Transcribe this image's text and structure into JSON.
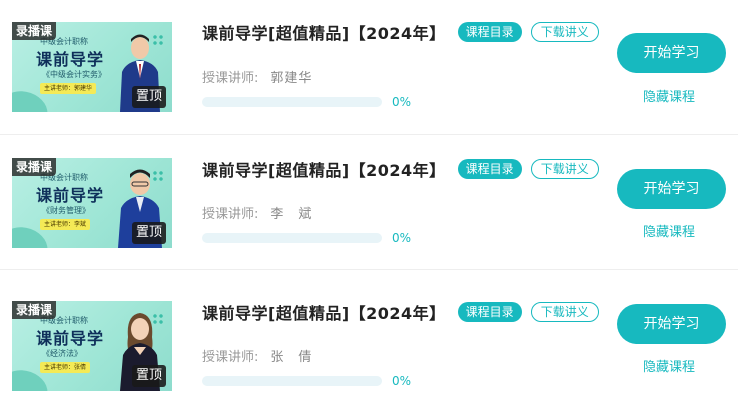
{
  "courses": [
    {
      "thumb": {
        "badge": "录播课",
        "subtitle": "中级会计职称",
        "big_title": "课前导学",
        "tagline": "《中级会计实务》",
        "teacher_pill": "主讲老师：郭建华",
        "pin_tag": "置顶",
        "suit_color": "#1f3a8a"
      },
      "title": "课前导学[超值精品]【2024年】",
      "catalog_label": "课程目录",
      "download_label": "下载讲义",
      "teacher_label": "授课讲师:",
      "teacher_name": "郭建华",
      "progress": 0,
      "progress_text": "0%",
      "start_label": "开始学习",
      "hide_label": "隐藏课程"
    },
    {
      "thumb": {
        "badge": "录播课",
        "subtitle": "中级会计职称",
        "big_title": "课前导学",
        "tagline": "《财务管理》",
        "teacher_pill": "主讲老师：李斌",
        "pin_tag": "置顶",
        "suit_color": "#1e3f9c"
      },
      "title": "课前导学[超值精品]【2024年】",
      "catalog_label": "课程目录",
      "download_label": "下载讲义",
      "teacher_label": "授课讲师:",
      "teacher_name": "李　斌",
      "progress": 0,
      "progress_text": "0%",
      "start_label": "开始学习",
      "hide_label": "隐藏课程"
    },
    {
      "thumb": {
        "badge": "录播课",
        "subtitle": "中级会计职称",
        "big_title": "课前导学",
        "tagline": "《经济法》",
        "teacher_pill": "主讲老师：张倩",
        "pin_tag": "置顶",
        "suit_color": "#1b1b2e"
      },
      "title": "课前导学[超值精品]【2024年】",
      "catalog_label": "课程目录",
      "download_label": "下载讲义",
      "teacher_label": "授课讲师:",
      "teacher_name": "张　倩",
      "progress": 0,
      "progress_text": "0%",
      "start_label": "开始学习",
      "hide_label": "隐藏课程"
    }
  ],
  "colors": {
    "accent": "#17b9bf",
    "title": "#222222",
    "muted": "#999999",
    "track": "#e8f4f8"
  },
  "icons": [
    "person-photo-icon",
    "dot-grid-icon"
  ]
}
